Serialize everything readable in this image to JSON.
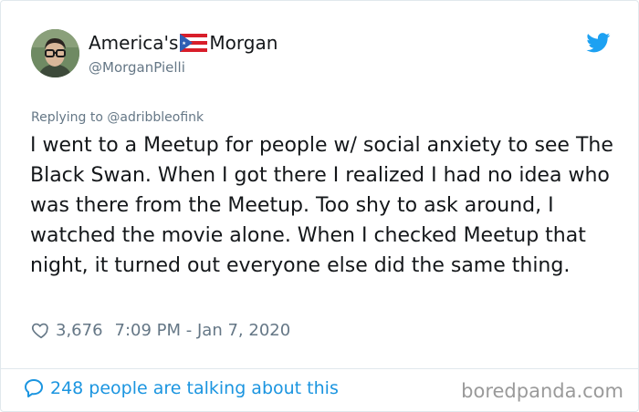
{
  "tweet": {
    "display_name_part1": "America's",
    "display_name_part2": "Morgan",
    "flag_icon": "puerto-rico-flag",
    "handle": "@MorganPielli",
    "reply_prefix": "Replying to ",
    "reply_handle": "@adribbleofink",
    "text": "I went to a Meetup for people w/ social anxiety to see The Black Swan. When I got there I realized I had no idea who was there from the Meetup. Too shy to ask around, I watched the movie alone. When I checked Meetup that night, it turned out everyone else did the same thing.",
    "likes": "3,676",
    "timestamp": "7:09 PM - Jan 7, 2020",
    "talking": "248 people are talking about this"
  },
  "watermark": "boredpanda.com",
  "colors": {
    "twitter_blue": "#1da1f2",
    "link_blue": "#1b95e0",
    "secondary_text": "#657786"
  }
}
